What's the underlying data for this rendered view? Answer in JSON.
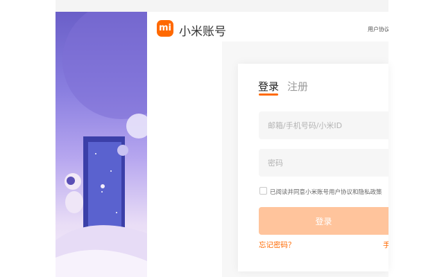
{
  "header": {
    "logo_text": "mi",
    "brand": "小米账号",
    "agreement_link": "用户协议"
  },
  "tabs": {
    "login": "登录",
    "register": "注册"
  },
  "form": {
    "account_placeholder": "邮箱/手机号码/小米ID",
    "password_placeholder": "密码",
    "agreement": "已阅读并同意小米账号用户协议和隐私政策",
    "login_button": "登录",
    "forgot_password": "忘记密码？",
    "phone_login_link": "手"
  },
  "colors": {
    "accent": "#ff6900",
    "button_disabled": "#ffc49c"
  }
}
